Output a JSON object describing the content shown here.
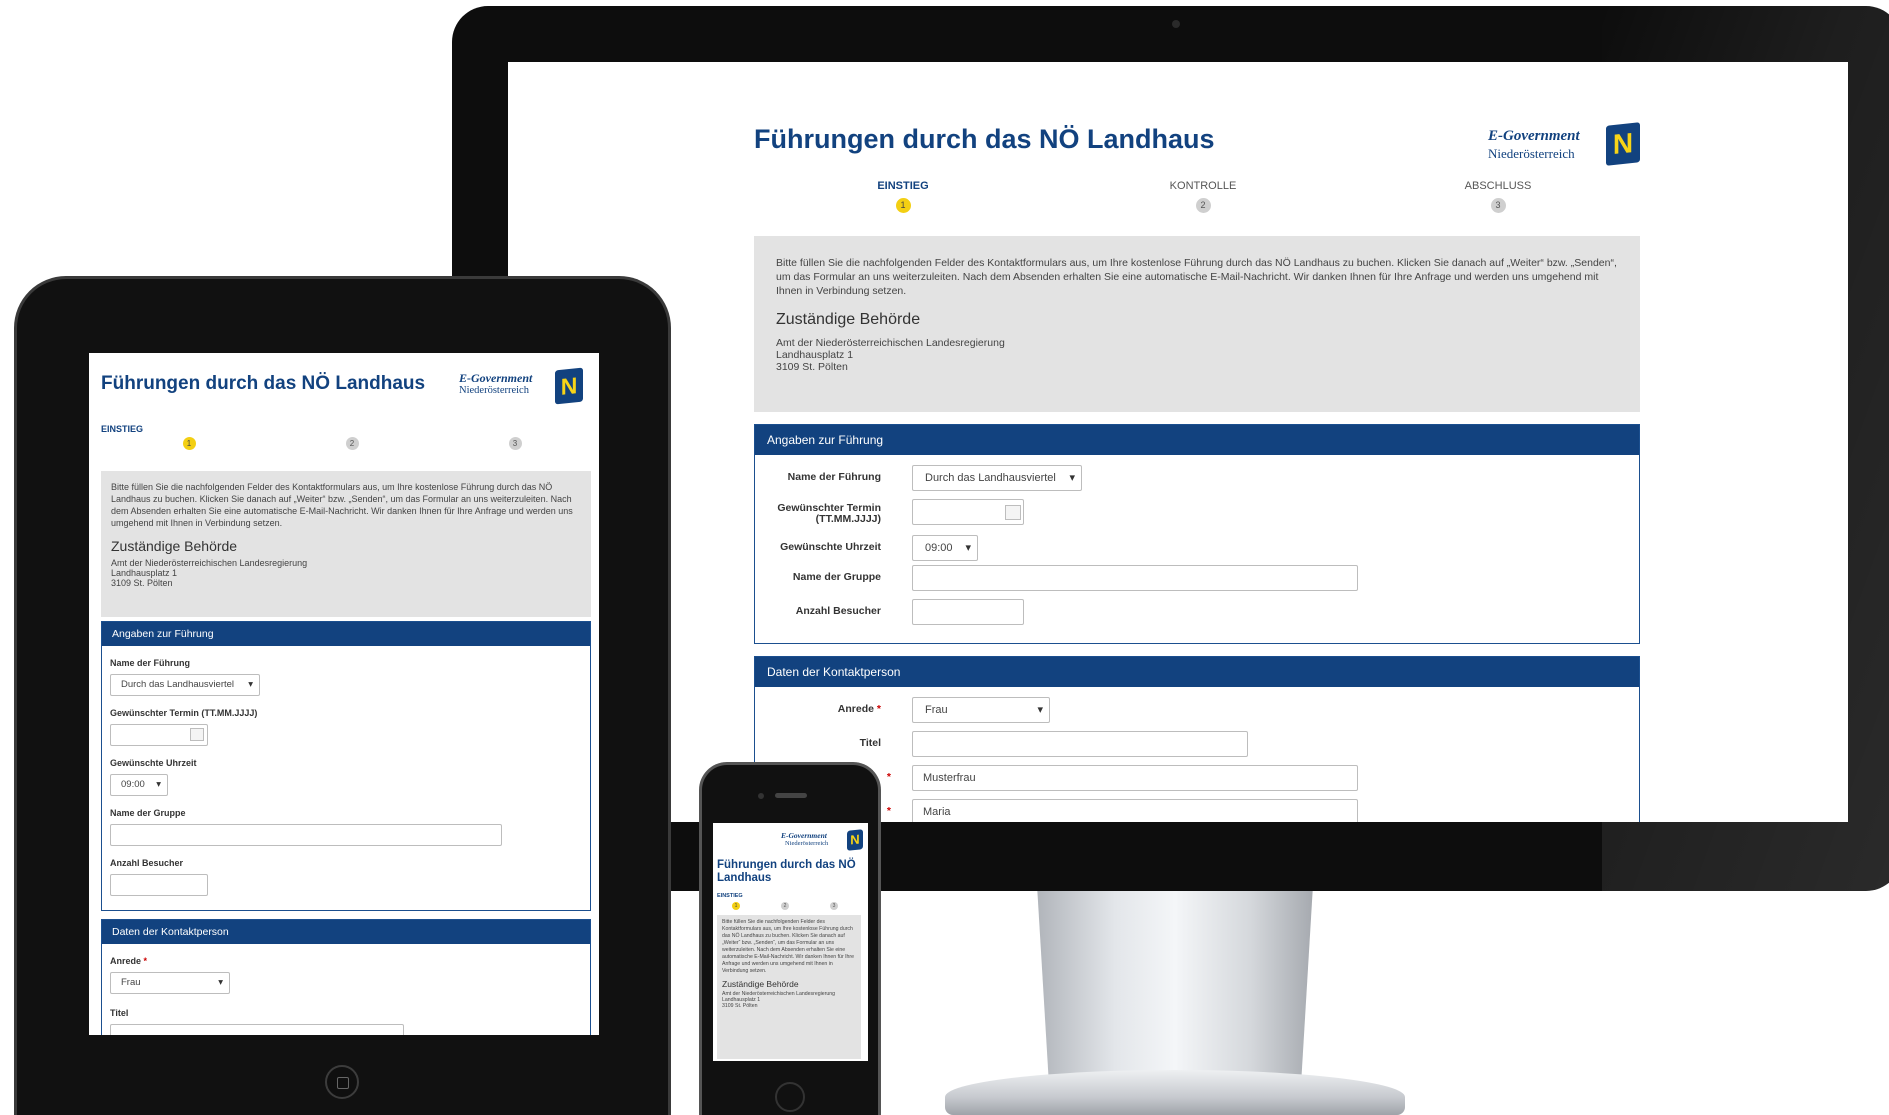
{
  "page": {
    "title": "Führungen durch das NÖ Landhaus",
    "logo": {
      "line1": "E-Government",
      "line2": "Niederösterreich",
      "badge": "N"
    },
    "steps": [
      {
        "label": "EINSTIEG",
        "number": "1"
      },
      {
        "label": "KONTROLLE",
        "number": "2"
      },
      {
        "label": "ABSCHLUSS",
        "number": "3"
      }
    ],
    "intro": {
      "text": "Bitte füllen Sie die nachfolgenden Felder des Kontaktformulars aus, um Ihre kostenlose Führung durch das NÖ Landhaus zu buchen. Klicken Sie danach auf „Weiter“ bzw. „Senden“, um das Formular an uns weiterzuleiten. Nach dem Absenden erhalten Sie eine automatische E-Mail-Nachricht. Wir danken Ihnen für Ihre Anfrage und werden uns umgehend mit Ihnen in Verbindung setzen.",
      "authority_heading": "Zuständige Behörde",
      "address_line1": "Amt der Niederösterreichischen Landesregierung",
      "address_line2": "Landhausplatz 1",
      "address_line3": "3109 St. Pölten"
    },
    "tour_section": {
      "heading": "Angaben zur Führung",
      "tour_name_label": "Name der Führung",
      "tour_name_value": "Durch das Landhausviertel",
      "date_label": "Gewünschter Termin (TT.MM.JJJJ)",
      "date_label_a": "Gewünschter Termin",
      "date_label_b": "(TT.MM.JJJJ)",
      "time_label": "Gewünschte Uhrzeit",
      "time_value": "09:00",
      "group_label": "Name der Gruppe",
      "visitors_label": "Anzahl Besucher"
    },
    "contact_section": {
      "heading": "Daten der Kontaktperson",
      "salutation_label": "Anrede",
      "required_mark": "*",
      "salutation_value": "Frau",
      "title_label": "Titel",
      "lastname_value": "Musterfrau",
      "firstname_value": "Maria"
    }
  },
  "colors": {
    "brand_blue": "#12427f",
    "active_step": "#f3cf13",
    "intro_bg": "#e3e3e3"
  }
}
